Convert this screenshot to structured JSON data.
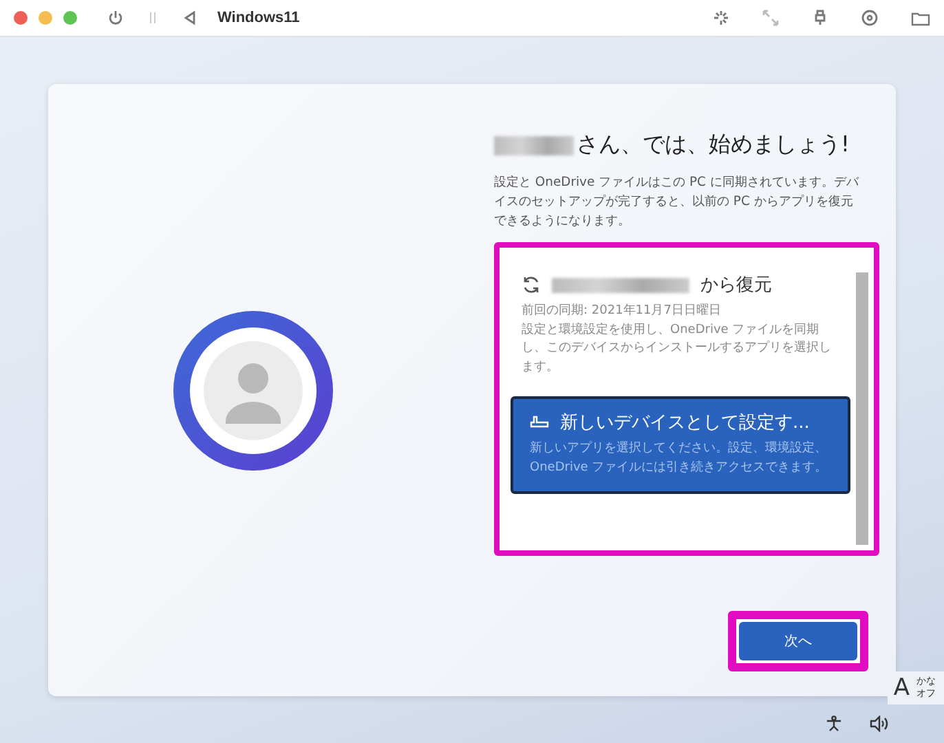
{
  "window": {
    "title": "Windows11"
  },
  "heading": {
    "name_redacted": true,
    "text": "さん、では、始めましょう!"
  },
  "description": "設定と OneDrive ファイルはこの PC に同期されています。デバイスのセットアップが完了すると、以前の PC からアプリを復元できるようになります。",
  "options_highlighted": true,
  "options": [
    {
      "kind": "restore",
      "name_redacted": true,
      "title": "から復元",
      "subtitle": "前回の同期: 2021年11月7日日曜日",
      "description": "設定と環境設定を使用し、OneDrive ファイルを同期し、このデバイスからインストールするアプリを選択します。",
      "selected": false
    },
    {
      "kind": "new",
      "title": "新しいデバイスとして設定す...",
      "description": "新しいアプリを選択してください。設定、環境設定、OneDrive ファイルには引き続きアクセスできます。",
      "selected": true
    }
  ],
  "next_button": {
    "label": "次へ",
    "highlighted": true
  },
  "ime": {
    "letter": "A",
    "mode_top": "かな",
    "mode_bottom": "オフ"
  }
}
